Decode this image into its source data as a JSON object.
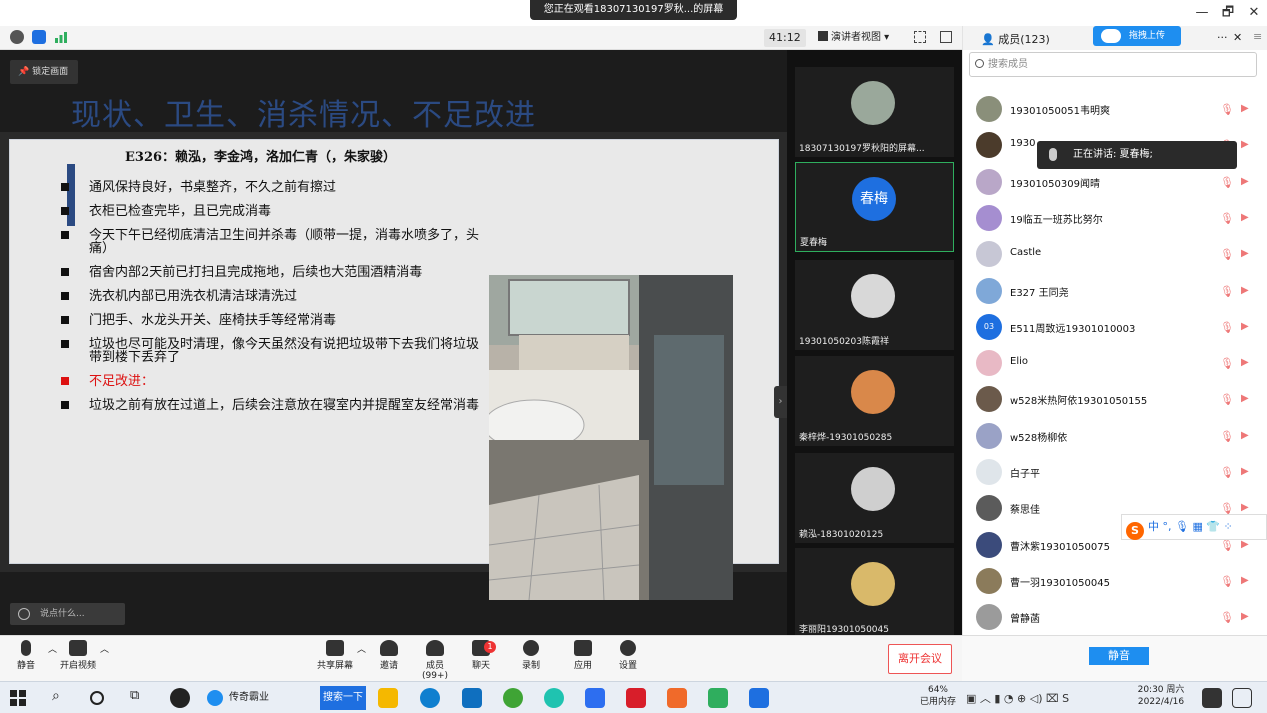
{
  "window": {
    "viewing_banner": "您正在观看18307130197罗秋...的屏幕",
    "minimize": "—",
    "restore": "🗗",
    "close": "✕"
  },
  "toolbar": {
    "timer": "41:12",
    "presenter_view": "演讲者视图 ▾"
  },
  "share": {
    "lock_label": "锁定画面",
    "chat_hint": "说点什么...",
    "slide": {
      "title": "现状、卫生、消杀情况、不足改进",
      "subtitle": "E326：赖泓，李金鸿，洛加仁青（，朱家骏）",
      "bullets": [
        {
          "text": "通风保持良好，书桌整齐，不久之前有擦过",
          "red": false
        },
        {
          "text": "衣柜已检查完毕，且已完成消毒",
          "red": false
        },
        {
          "text": "今天下午已经彻底清洁卫生间并杀毒（顺带一提，消毒水喷多了，头痛）",
          "red": false
        },
        {
          "text": "宿舍内部2天前已打扫且完成拖地，后续也大范围酒精消毒",
          "red": false
        },
        {
          "text": "洗衣机内部已用洗衣机清洁球清洗过",
          "red": false
        },
        {
          "text": "门把手、水龙头开关、座椅扶手等经常消毒",
          "red": false
        },
        {
          "text": "垃圾也尽可能及时清理，像今天虽然没有说把垃圾带下去我们将垃圾带到楼下丢弃了",
          "red": false
        },
        {
          "text": "不足改进：",
          "red": true
        },
        {
          "text": "垃圾之前有放在过道上，后续会注意放在寝室内并提醒室友经常消毒",
          "red": false
        }
      ]
    }
  },
  "video_tiles": [
    {
      "name": "18307130197罗秋阳的屏幕...",
      "avatar_text": ""
    },
    {
      "name": "夏春梅",
      "avatar_text": "春梅"
    },
    {
      "name": "19301050203陈霞祥",
      "avatar_text": ""
    },
    {
      "name": "秦梓烨-19301050285",
      "avatar_text": ""
    },
    {
      "name": "赖泓-18301020125",
      "avatar_text": ""
    },
    {
      "name": "李丽阳19301050045",
      "avatar_text": ""
    }
  ],
  "panel": {
    "title": "成员(123)",
    "drag_upload": "拖拽上传",
    "more": "···",
    "close": "✕",
    "search_placeholder": "搜索成员",
    "speaking": "正在讲话: 夏春梅;",
    "ime_label": "中 °, 🎙 ▦ 👕 ⁘",
    "mute_all": "静音",
    "members": [
      {
        "name": "19301050051韦明爽",
        "avatar_text": "",
        "color": "#8a8f7a"
      },
      {
        "name": "1930",
        "avatar_text": "",
        "color": "#4b3b2b"
      },
      {
        "name": "19301050309闻晴",
        "avatar_text": "",
        "color": "#b9a7c8"
      },
      {
        "name": "19临五一班苏比努尔",
        "avatar_text": "",
        "color": "#a58ed0"
      },
      {
        "name": "Castle",
        "avatar_text": "",
        "color": "#c7c7d5"
      },
      {
        "name": "E327 王同尧",
        "avatar_text": "",
        "color": "#7fa8d8"
      },
      {
        "name": "E511周致远19301010003",
        "avatar_text": "03",
        "color": "#1e6fe0"
      },
      {
        "name": "Elio",
        "avatar_text": "",
        "color": "#e8b9c5"
      },
      {
        "name": "w528米热阿依19301050155",
        "avatar_text": "",
        "color": "#6b5a4b"
      },
      {
        "name": "w528杨柳依",
        "avatar_text": "",
        "color": "#9aa2c6"
      },
      {
        "name": "白子平",
        "avatar_text": "",
        "color": "#dfe5ea"
      },
      {
        "name": "蔡思佳",
        "avatar_text": "",
        "color": "#5b5b5b"
      },
      {
        "name": "曹沐紫19301050075",
        "avatar_text": "",
        "color": "#3b4b7b"
      },
      {
        "name": "曹一羽19301050045",
        "avatar_text": "",
        "color": "#8b7b5b"
      },
      {
        "name": "曾静菡",
        "avatar_text": "",
        "color": "#9b9b9b"
      }
    ]
  },
  "bottom_bar": {
    "mute": "静音",
    "video": "开启视频",
    "share": "共享屏幕",
    "invite": "邀请",
    "members": "成员(99+)",
    "chat": "聊天",
    "chat_badge": "1",
    "record": "录制",
    "apps": "应用",
    "settings": "设置",
    "end_meeting": "离开会议"
  },
  "taskbar": {
    "browser_label": "传奇霸业",
    "search_label": "搜索一下",
    "memory_percent": "64%",
    "memory_label": "已用内存",
    "time": "20:30 周六",
    "date": "2022/4/16"
  }
}
